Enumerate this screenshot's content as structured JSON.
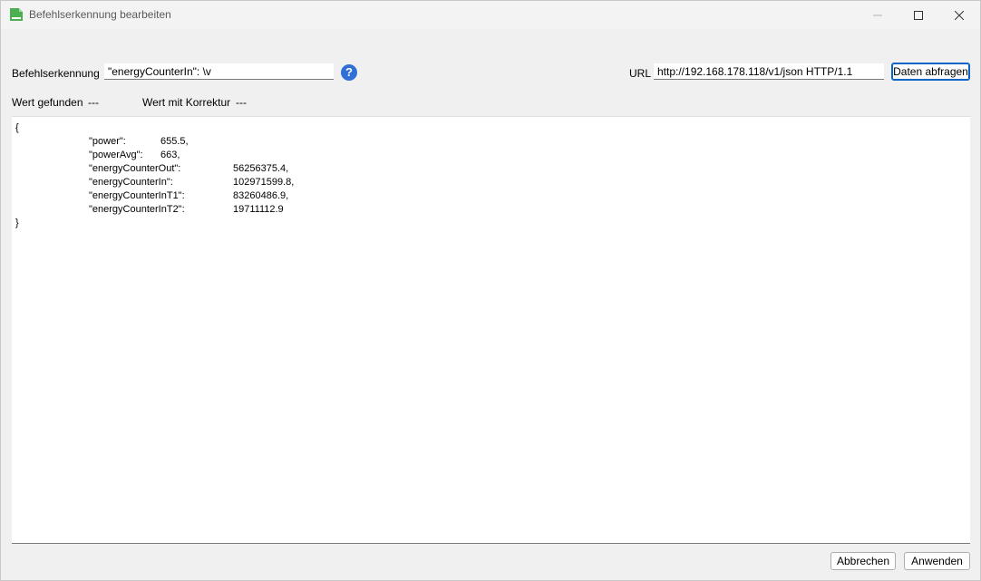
{
  "window": {
    "title": "Befehlserkennung bearbeiten"
  },
  "form": {
    "command_label": "Befehlserkennung",
    "command_value": "\"energyCounterIn\": \\v",
    "url_label": "URL",
    "url_value": "http://192.168.178.118/v1/json HTTP/1.1",
    "fetch_button": "Daten abfragen",
    "help_glyph": "?"
  },
  "status": {
    "found_label": "Wert gefunden",
    "found_value": "---",
    "corrected_label": "Wert mit Korrektur",
    "corrected_value": "---"
  },
  "output": {
    "open": "{",
    "close": "}",
    "lines": [
      {
        "key": "\"power\":",
        "value": "655.5,"
      },
      {
        "key": "\"powerAvg\":",
        "value": "663,"
      },
      {
        "key": "\"energyCounterOut\":",
        "value": "56256375.4,"
      },
      {
        "key": "\"energyCounterIn\":",
        "value": "102971599.8,"
      },
      {
        "key": "\"energyCounterInT1\":",
        "value": "83260486.9,"
      },
      {
        "key": "\"energyCounterInT2\":",
        "value": "19711112.9"
      }
    ]
  },
  "footer": {
    "cancel": "Abbrechen",
    "apply": "Anwenden"
  },
  "icons": {
    "app": "document-icon",
    "minimize": "minimize-icon",
    "maximize": "maximize-icon",
    "close": "close-icon",
    "help": "help-icon"
  },
  "colors": {
    "accent": "#0a64c8",
    "help": "#2f6fd6",
    "app_icon": "#4caf50"
  }
}
